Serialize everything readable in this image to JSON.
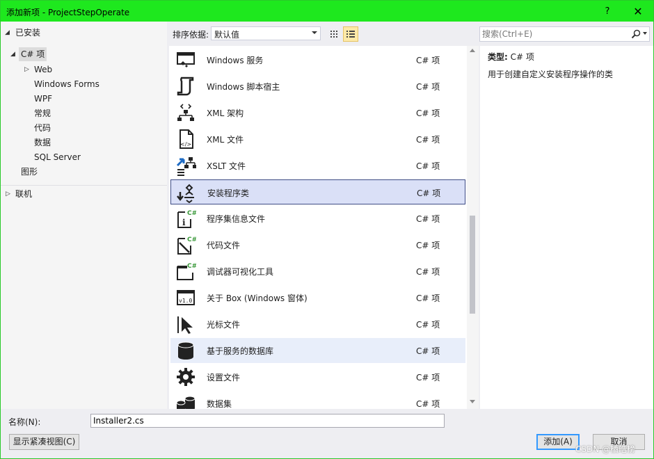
{
  "window": {
    "title": "添加新项 - ProjectStepOperate",
    "help_label": "?",
    "close_label": "✕"
  },
  "tree": {
    "installed_label": "已安装",
    "csharp_label": "C# 项",
    "children": [
      "Web",
      "Windows Forms",
      "WPF",
      "常规",
      "代码",
      "数据",
      "SQL Server"
    ],
    "graphics_label": "图形",
    "online_label": "联机"
  },
  "toolbar": {
    "sort_label": "排序依据:",
    "sort_value": "默认值",
    "search_placeholder": "搜索(Ctrl+E)"
  },
  "items": [
    {
      "name": "Windows 服务",
      "type": "C# 项",
      "icon": "windows-service-icon"
    },
    {
      "name": "Windows 脚本宿主",
      "type": "C# 项",
      "icon": "script-host-icon"
    },
    {
      "name": "XML 架构",
      "type": "C# 项",
      "icon": "xml-schema-icon"
    },
    {
      "name": "XML 文件",
      "type": "C# 项",
      "icon": "xml-file-icon"
    },
    {
      "name": "XSLT 文件",
      "type": "C# 项",
      "icon": "xslt-file-icon"
    },
    {
      "name": "安装程序类",
      "type": "C# 项",
      "icon": "installer-class-icon"
    },
    {
      "name": "程序集信息文件",
      "type": "C# 项",
      "icon": "assembly-info-icon"
    },
    {
      "name": "代码文件",
      "type": "C# 项",
      "icon": "code-file-icon"
    },
    {
      "name": "调试器可视化工具",
      "type": "C# 项",
      "icon": "debugger-visualizer-icon"
    },
    {
      "name": "关于 Box (Windows 窗体)",
      "type": "C# 项",
      "icon": "about-box-icon"
    },
    {
      "name": "光标文件",
      "type": "C# 项",
      "icon": "cursor-file-icon"
    },
    {
      "name": "基于服务的数据库",
      "type": "C# 项",
      "icon": "service-database-icon"
    },
    {
      "name": "设置文件",
      "type": "C# 项",
      "icon": "settings-file-icon"
    },
    {
      "name": "数据集",
      "type": "C# 项",
      "icon": "dataset-icon"
    }
  ],
  "description": {
    "type_label": "类型:",
    "type_value": "C# 项",
    "text": "用于创建自定义安装程序操作的类"
  },
  "bottom": {
    "name_label": "名称(N):",
    "name_value": "Installer2.cs",
    "compact_view_label": "显示紧凑视图(C)",
    "add_label": "添加(A)",
    "cancel_label": "取消"
  },
  "watermark": "CSDN @栖皓榜"
}
